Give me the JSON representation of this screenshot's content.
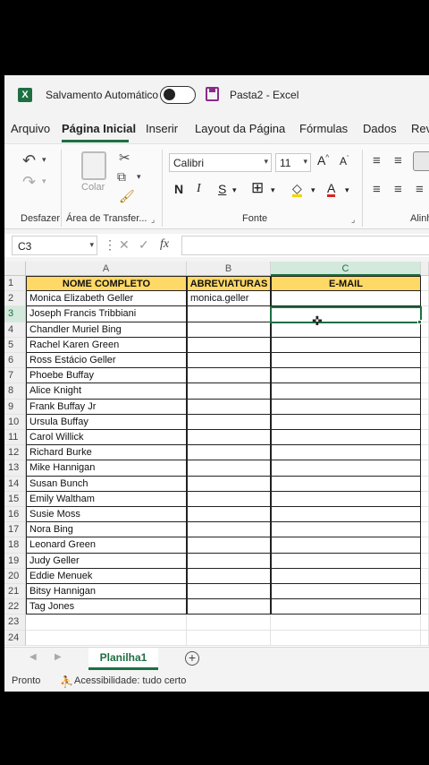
{
  "titlebar": {
    "autosave_label": "Salvamento Automático",
    "doc_title": "Pasta2  -  Excel"
  },
  "tabs": [
    "Arquivo",
    "Página Inicial",
    "Inserir",
    "Layout da Página",
    "Fórmulas",
    "Dados",
    "Rev"
  ],
  "ribbon": {
    "undo_group_label": "Desfazer",
    "clipboard_label": "Área de Transfer...",
    "paste_label": "Colar",
    "font_name": "Calibri",
    "font_size": "11",
    "font_group_label": "Fonte",
    "alignment_label": "Alinh"
  },
  "formula_bar": {
    "name_box": "C3",
    "fx": "fx",
    "value": ""
  },
  "sheet": {
    "columns": [
      "A",
      "B",
      "C"
    ],
    "headers": [
      "NOME COMPLETO",
      "ABREVIATURAS",
      "E-MAIL"
    ],
    "rows": [
      {
        "n": "1"
      },
      {
        "n": "2",
        "a": "Monica Elizabeth Geller",
        "b": "monica.geller",
        "c": ""
      },
      {
        "n": "3",
        "a": "Joseph Francis Tribbiani",
        "b": "",
        "c": ""
      },
      {
        "n": "4",
        "a": "Chandler Muriel Bing",
        "b": "",
        "c": ""
      },
      {
        "n": "5",
        "a": " Rachel Karen Green",
        "b": "",
        "c": ""
      },
      {
        "n": "6",
        "a": "Ross Estácio Geller",
        "b": "",
        "c": ""
      },
      {
        "n": "7",
        "a": "Phoebe Buffay",
        "b": "",
        "c": ""
      },
      {
        "n": "8",
        "a": "Alice Knight",
        "b": "",
        "c": ""
      },
      {
        "n": "9",
        "a": "Frank Buffay Jr",
        "b": "",
        "c": ""
      },
      {
        "n": "10",
        "a": "Ursula Buffay",
        "b": "",
        "c": ""
      },
      {
        "n": "11",
        "a": "Carol Willick",
        "b": "",
        "c": ""
      },
      {
        "n": "12",
        "a": "Richard Burke",
        "b": "",
        "c": ""
      },
      {
        "n": "13",
        "a": " Mike Hannigan",
        "b": "",
        "c": ""
      },
      {
        "n": "14",
        "a": "Susan Bunch",
        "b": "",
        "c": ""
      },
      {
        "n": "15",
        "a": "Emily Waltham",
        "b": "",
        "c": ""
      },
      {
        "n": "16",
        "a": "Susie Moss",
        "b": "",
        "c": ""
      },
      {
        "n": "17",
        "a": "Nora Bing",
        "b": "",
        "c": ""
      },
      {
        "n": "18",
        "a": "Leonard Green",
        "b": "",
        "c": ""
      },
      {
        "n": "19",
        "a": "Judy Geller",
        "b": "",
        "c": ""
      },
      {
        "n": "20",
        "a": "Eddie Menuek",
        "b": "",
        "c": ""
      },
      {
        "n": "21",
        "a": "Bitsy Hannigan",
        "b": "",
        "c": ""
      },
      {
        "n": "22",
        "a": "Tag Jones",
        "b": "",
        "c": ""
      },
      {
        "n": "23"
      },
      {
        "n": "24"
      }
    ],
    "selected_cell": "C3"
  },
  "sheet_tabs": {
    "active": "Planilha1"
  },
  "status": {
    "ready": "Pronto",
    "accessibility": "Acessibilidade: tudo certo"
  },
  "colors": {
    "excel_green": "#1d6f42",
    "header_fill": "#ffd966"
  }
}
